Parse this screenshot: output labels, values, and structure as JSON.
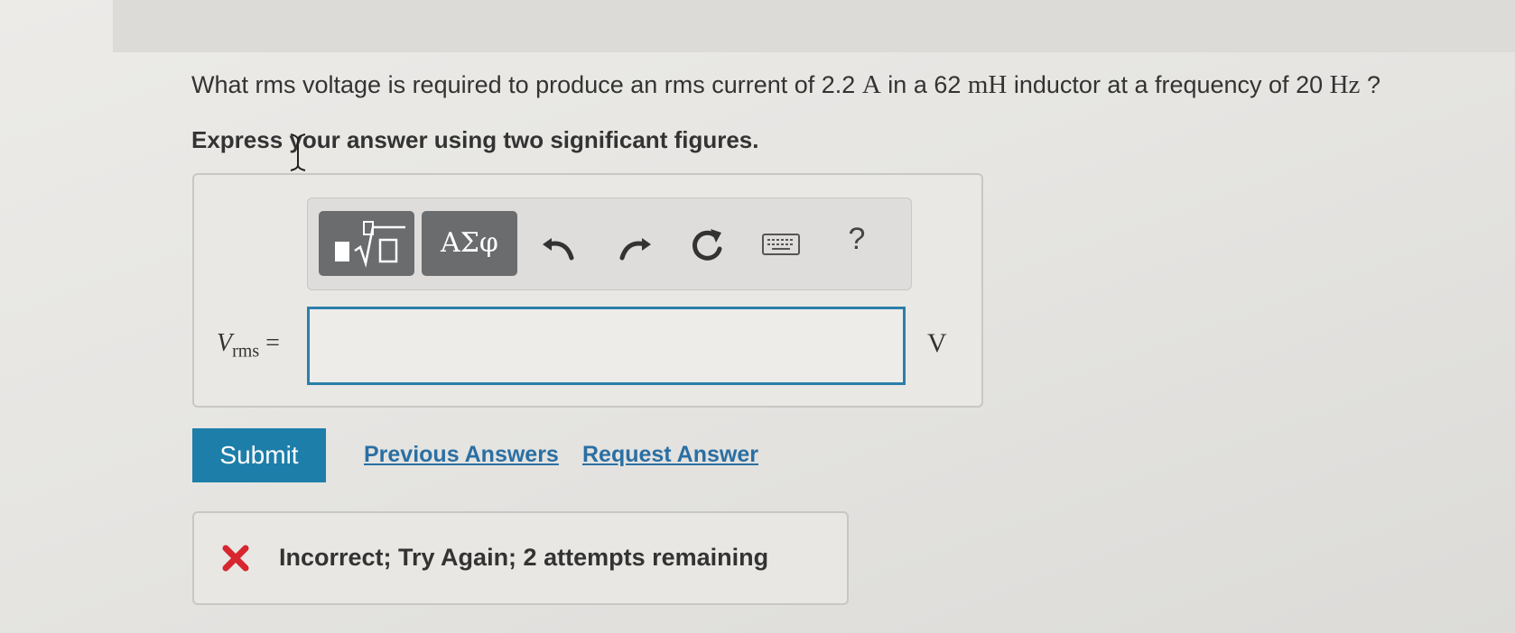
{
  "question": {
    "part1": "What rms voltage is required to produce an rms current of 2.2 ",
    "current_unit": "A",
    "part2": " in a 62 ",
    "inductance_unit": "mH",
    "part3": " inductor at a frequency of 20 ",
    "frequency_unit": "Hz",
    "part4": " ?"
  },
  "instruction": "Express your answer using two significant figures.",
  "toolbar": {
    "greek_label": "ΑΣφ",
    "help_label": "?"
  },
  "answer": {
    "variable": "V",
    "subscript": "rms",
    "equals": " =",
    "value": "",
    "unit": "V"
  },
  "actions": {
    "submit_label": "Submit",
    "previous_answers_label": "Previous Answers",
    "request_answer_label": "Request Answer"
  },
  "feedback": {
    "message": "Incorrect; Try Again; 2 attempts remaining",
    "status_color": "#d7262e"
  },
  "colors": {
    "accent": "#1d7ea9",
    "link": "#2a6fa3",
    "toolbar_button": "#6b6c6e"
  }
}
